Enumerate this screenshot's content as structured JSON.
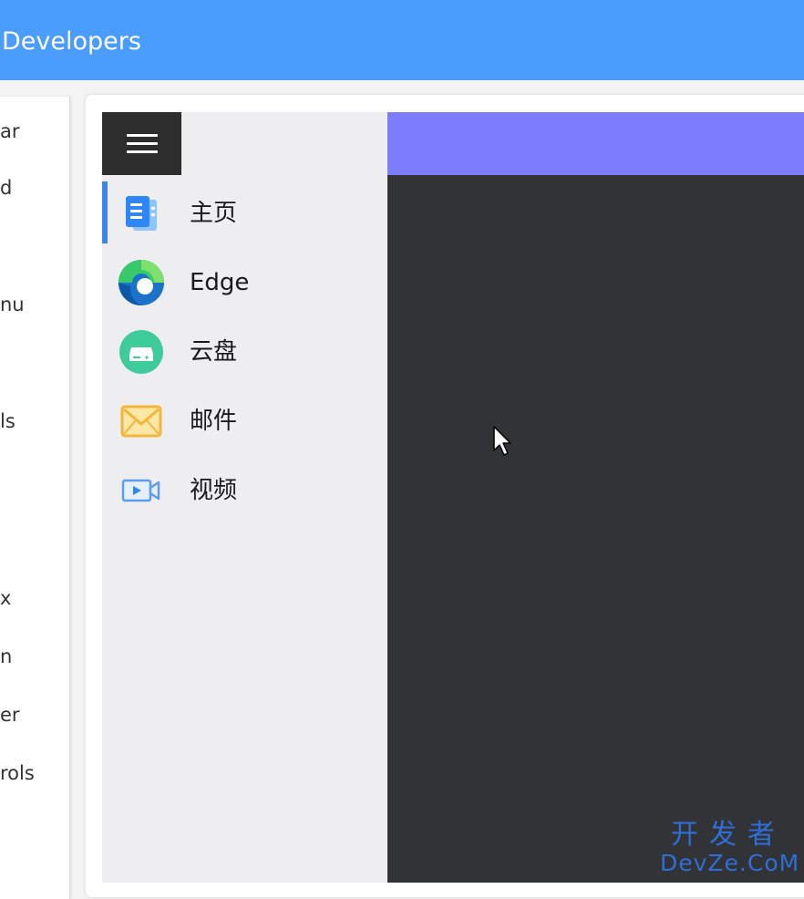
{
  "window": {
    "title": "Developers"
  },
  "left_panel": {
    "items": [
      "ar",
      "d",
      "nu",
      "ls",
      "x",
      "n",
      "er",
      "rols"
    ]
  },
  "nav": {
    "menu_icon": "hamburger-icon",
    "items": [
      {
        "label": "主页",
        "icon": "document-icon",
        "selected": true
      },
      {
        "label": "Edge",
        "icon": "edge-browser-icon",
        "selected": false
      },
      {
        "label": "云盘",
        "icon": "cloud-drive-icon",
        "selected": false
      },
      {
        "label": "邮件",
        "icon": "mail-icon",
        "selected": false
      },
      {
        "label": "视频",
        "icon": "video-icon",
        "selected": false
      }
    ]
  },
  "colors": {
    "topbar": "#4a9dfd",
    "content_header": "#7c7cfc",
    "content_body": "#323337",
    "nav_background": "#eeeef1",
    "selected_indicator": "#3d86e8"
  },
  "watermark": {
    "line1": "开发者",
    "line2": "DevZe.CoM"
  }
}
